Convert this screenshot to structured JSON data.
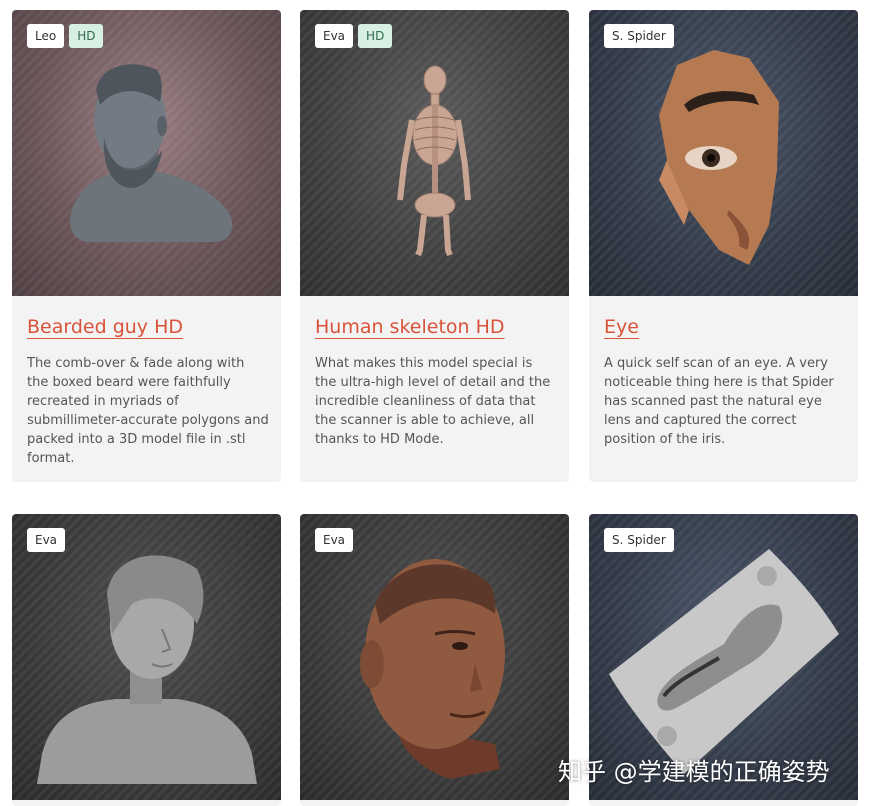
{
  "cards": [
    {
      "tags": [
        "Leo",
        "HD"
      ],
      "title": "Bearded guy HD",
      "desc": "The comb-over & fade along with the boxed beard were faithfully recreated in myriads of submillimeter-accurate polygons and packed into a 3D model file in .stl format."
    },
    {
      "tags": [
        "Eva",
        "HD"
      ],
      "title": "Human skeleton HD",
      "desc": "What makes this model special is the ultra-high level of detail and the incredible cleanliness of data that the scanner is able to achieve, all thanks to HD Mode."
    },
    {
      "tags": [
        "S. Spider"
      ],
      "title": "Eye",
      "desc": "A quick self scan of an eye. A very noticeable thing here is that Spider has scanned past the natural eye lens and captured the correct position of the iris."
    },
    {
      "tags": [
        "Eva"
      ]
    },
    {
      "tags": [
        "Eva"
      ]
    },
    {
      "tags": [
        "S. Spider"
      ]
    }
  ],
  "watermark": "知乎 @学建模的正确姿势",
  "colors": {
    "title": "#d9533a",
    "hd_badge_bg": "#d8efe3",
    "card_bg": "#f3f3f3"
  }
}
